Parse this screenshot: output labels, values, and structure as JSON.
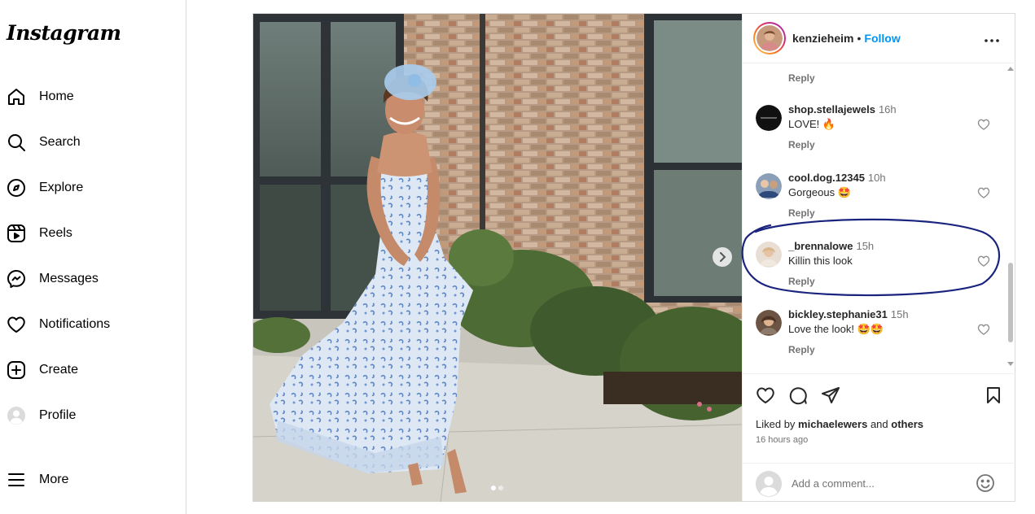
{
  "sidebar": {
    "logo": "Instagram",
    "items": [
      {
        "label": "Home",
        "icon": "home-icon"
      },
      {
        "label": "Search",
        "icon": "search-icon"
      },
      {
        "label": "Explore",
        "icon": "compass-icon"
      },
      {
        "label": "Reels",
        "icon": "reels-icon"
      },
      {
        "label": "Messages",
        "icon": "messenger-icon"
      },
      {
        "label": "Notifications",
        "icon": "heart-icon"
      },
      {
        "label": "Create",
        "icon": "plus-square-icon"
      },
      {
        "label": "Profile",
        "icon": "profile-avatar-icon"
      }
    ],
    "more_label": "More"
  },
  "post": {
    "carousel": {
      "slide_count": 2,
      "active_slide": 1
    }
  },
  "header": {
    "username": "kenzieheim",
    "separator": "•",
    "follow_label": "Follow"
  },
  "comments": {
    "top_reply": "Reply",
    "items": [
      {
        "username": "shop.stellajewels",
        "time": "16h",
        "text": "LOVE! 🔥",
        "reply": "Reply"
      },
      {
        "username": "cool.dog.12345",
        "time": "10h",
        "text": "Gorgeous 🤩",
        "reply": "Reply"
      },
      {
        "username": "_brennalowe",
        "time": "15h",
        "text": "Killin this look",
        "reply": "Reply",
        "highlighted": true
      },
      {
        "username": "bickley.stephanie31",
        "time": "15h",
        "text": "Love the look! 🤩🤩",
        "reply": "Reply"
      }
    ]
  },
  "actions": {
    "liked_by_prefix": "Liked by ",
    "liked_by_user": "michaelewers",
    "liked_by_and": " and ",
    "liked_by_others": "others",
    "time_ago": "16 hours ago"
  },
  "add_comment": {
    "placeholder": "Add a comment..."
  },
  "colors": {
    "follow_blue": "#0095f6",
    "annotation_ink": "#1a237e",
    "border": "#dbdbdb"
  }
}
